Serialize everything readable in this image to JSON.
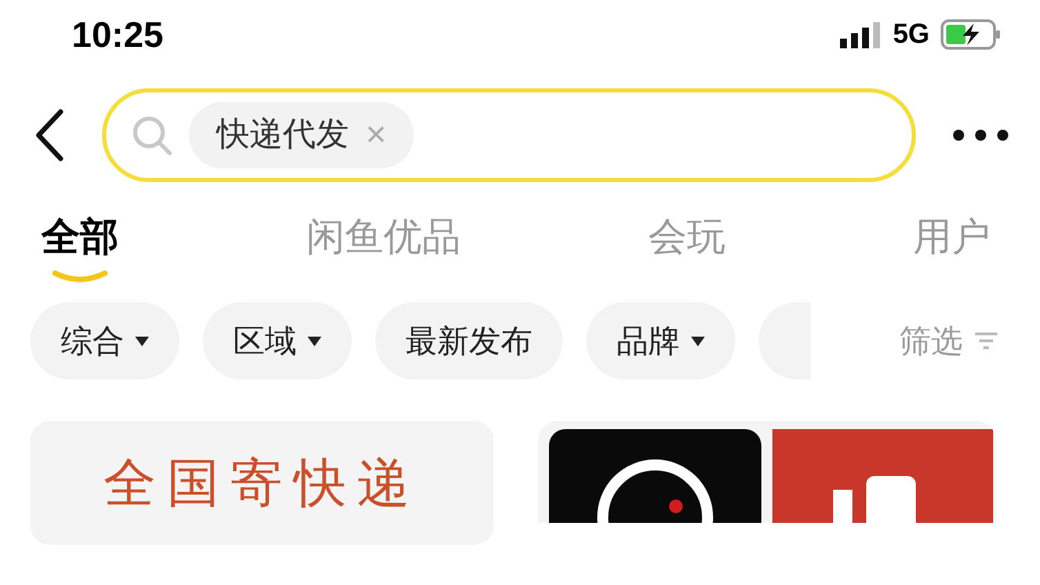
{
  "status_bar": {
    "time": "10:25",
    "network": "5G"
  },
  "search": {
    "tag": "快递代发",
    "tag_close": "×"
  },
  "tabs": [
    {
      "label": "全部",
      "selected": true
    },
    {
      "label": "闲鱼优品",
      "selected": false
    },
    {
      "label": "会玩",
      "selected": false
    },
    {
      "label": "用户",
      "selected": false
    }
  ],
  "filters": [
    {
      "label": "综合",
      "dropdown": true
    },
    {
      "label": "区域",
      "dropdown": true
    },
    {
      "label": "最新发布",
      "dropdown": false
    },
    {
      "label": "品牌",
      "dropdown": true
    },
    {
      "dropdown": false
    }
  ],
  "filter_button": "筛选",
  "cards": [
    {
      "kind": "text",
      "title": "全国寄快递"
    },
    {
      "kind": "picture"
    }
  ]
}
